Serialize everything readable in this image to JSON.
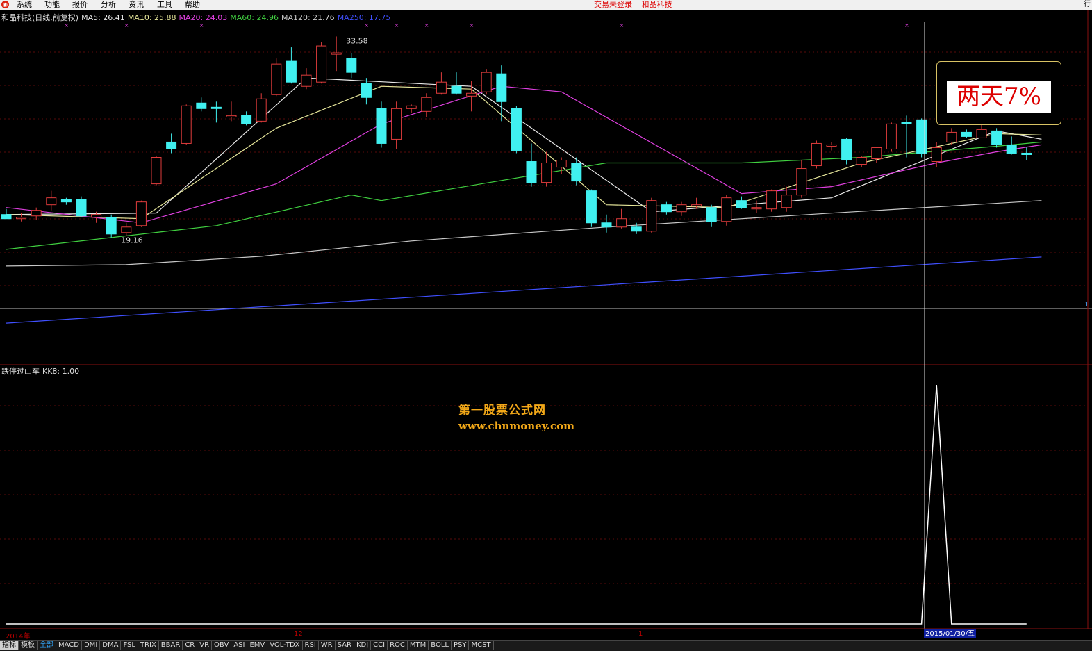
{
  "menu": {
    "logo": "◉",
    "items": [
      "系统",
      "功能",
      "报价",
      "分析",
      "资讯",
      "工具",
      "帮助"
    ],
    "status": "交易未登录",
    "stock_name": "和晶科技",
    "right_text": "行"
  },
  "main_legend": [
    {
      "label": "和晶科技(日线,前复权)",
      "color": "#e0e0e0"
    },
    {
      "label": "MA5: 26.41",
      "color": "#e8e8e8"
    },
    {
      "label": "MA10: 25.88",
      "color": "#e6e69a"
    },
    {
      "label": "MA20: 24.03",
      "color": "#e040e0"
    },
    {
      "label": "MA60: 24.96",
      "color": "#40d040"
    },
    {
      "label": "MA120: 21.76",
      "color": "#c8c8c8"
    },
    {
      "label": "MA250: 17.75",
      "color": "#4050ff"
    }
  ],
  "price_labels": {
    "high": "33.58",
    "low": "19.16",
    "axis_mark": "1"
  },
  "callout": {
    "text": "两天7%"
  },
  "indicator_legend": {
    "name": "跌停过山车",
    "value": "KK8: 1.00"
  },
  "watermark": {
    "line1": "第一股票公式网",
    "line2": "www.chnmoney.com"
  },
  "time_axis": {
    "labels": [
      "2014年",
      "12",
      "1"
    ],
    "cursor_date": "2015/01/30/五"
  },
  "tabs": [
    {
      "label": "指标",
      "state": "hi"
    },
    {
      "label": "模板",
      "state": ""
    },
    {
      "label": "全部",
      "state": "sel"
    },
    {
      "label": "MACD",
      "state": ""
    },
    {
      "label": "DMI",
      "state": ""
    },
    {
      "label": "DMA",
      "state": ""
    },
    {
      "label": "FSL",
      "state": ""
    },
    {
      "label": "TRIX",
      "state": ""
    },
    {
      "label": "BBAR",
      "state": ""
    },
    {
      "label": "CR",
      "state": ""
    },
    {
      "label": "VR",
      "state": ""
    },
    {
      "label": "OBV",
      "state": ""
    },
    {
      "label": "ASI",
      "state": ""
    },
    {
      "label": "EMV",
      "state": ""
    },
    {
      "label": "VOL-TDX",
      "state": ""
    },
    {
      "label": "RSI",
      "state": ""
    },
    {
      "label": "WR",
      "state": ""
    },
    {
      "label": "SAR",
      "state": ""
    },
    {
      "label": "KDJ",
      "state": ""
    },
    {
      "label": "CCI",
      "state": ""
    },
    {
      "label": "ROC",
      "state": ""
    },
    {
      "label": "MTM",
      "state": ""
    },
    {
      "label": "BOLL",
      "state": ""
    },
    {
      "label": "PSY",
      "state": ""
    },
    {
      "label": "MCST",
      "state": ""
    }
  ],
  "chart_data": {
    "type": "candlestick",
    "price_range": [
      15.5,
      34.2
    ],
    "colors": {
      "up": "#e03c3c",
      "down": "#40f0f0"
    },
    "candles": [
      {
        "o": 20.8,
        "h": 21.2,
        "l": 20.5,
        "c": 20.5
      },
      {
        "o": 20.5,
        "h": 20.9,
        "l": 20.3,
        "c": 20.6
      },
      {
        "o": 20.7,
        "h": 21.3,
        "l": 20.4,
        "c": 21.1
      },
      {
        "o": 21.5,
        "h": 22.5,
        "l": 21.1,
        "c": 22.0
      },
      {
        "o": 21.9,
        "h": 22.0,
        "l": 21.5,
        "c": 21.7
      },
      {
        "o": 21.9,
        "h": 22.1,
        "l": 20.6,
        "c": 20.7
      },
      {
        "o": 20.6,
        "h": 21.0,
        "l": 20.2,
        "c": 20.8
      },
      {
        "o": 20.6,
        "h": 20.8,
        "l": 19.16,
        "c": 19.4
      },
      {
        "o": 19.5,
        "h": 20.2,
        "l": 19.3,
        "c": 19.9
      },
      {
        "o": 20.0,
        "h": 21.8,
        "l": 19.9,
        "c": 21.7
      },
      {
        "o": 23.0,
        "h": 25.0,
        "l": 22.9,
        "c": 24.9
      },
      {
        "o": 26.0,
        "h": 26.6,
        "l": 25.2,
        "c": 25.5
      },
      {
        "o": 25.9,
        "h": 28.7,
        "l": 25.8,
        "c": 28.6
      },
      {
        "o": 28.8,
        "h": 29.2,
        "l": 28.2,
        "c": 28.4
      },
      {
        "o": 28.5,
        "h": 28.9,
        "l": 27.4,
        "c": 28.4
      },
      {
        "o": 27.8,
        "h": 28.9,
        "l": 27.5,
        "c": 27.9
      },
      {
        "o": 27.9,
        "h": 28.2,
        "l": 27.2,
        "c": 27.3
      },
      {
        "o": 27.5,
        "h": 29.5,
        "l": 27.4,
        "c": 29.1
      },
      {
        "o": 29.4,
        "h": 32.0,
        "l": 29.3,
        "c": 31.6
      },
      {
        "o": 31.8,
        "h": 32.8,
        "l": 30.2,
        "c": 30.3
      },
      {
        "o": 30.0,
        "h": 31.3,
        "l": 29.8,
        "c": 30.8
      },
      {
        "o": 30.3,
        "h": 33.2,
        "l": 30.2,
        "c": 32.9
      },
      {
        "o": 32.3,
        "h": 33.58,
        "l": 31.1,
        "c": 32.4
      },
      {
        "o": 32.0,
        "h": 32.4,
        "l": 30.6,
        "c": 31.0
      },
      {
        "o": 30.2,
        "h": 30.6,
        "l": 28.7,
        "c": 29.2
      },
      {
        "o": 28.4,
        "h": 28.9,
        "l": 25.6,
        "c": 25.9
      },
      {
        "o": 26.2,
        "h": 28.9,
        "l": 25.5,
        "c": 28.4
      },
      {
        "o": 28.4,
        "h": 28.7,
        "l": 28.1,
        "c": 28.6
      },
      {
        "o": 28.2,
        "h": 29.5,
        "l": 27.8,
        "c": 29.2
      },
      {
        "o": 29.5,
        "h": 31.0,
        "l": 29.4,
        "c": 30.3
      },
      {
        "o": 30.0,
        "h": 31.0,
        "l": 29.4,
        "c": 29.5
      },
      {
        "o": 29.3,
        "h": 30.4,
        "l": 28.2,
        "c": 29.5
      },
      {
        "o": 29.6,
        "h": 31.2,
        "l": 29.4,
        "c": 31.0
      },
      {
        "o": 30.9,
        "h": 31.5,
        "l": 27.5,
        "c": 28.9
      },
      {
        "o": 28.4,
        "h": 28.6,
        "l": 25.2,
        "c": 25.4
      },
      {
        "o": 24.6,
        "h": 25.9,
        "l": 22.8,
        "c": 23.1
      },
      {
        "o": 23.1,
        "h": 25.3,
        "l": 22.8,
        "c": 24.5
      },
      {
        "o": 24.2,
        "h": 24.9,
        "l": 23.7,
        "c": 24.7
      },
      {
        "o": 24.5,
        "h": 24.9,
        "l": 22.9,
        "c": 23.2
      },
      {
        "o": 22.5,
        "h": 22.6,
        "l": 19.9,
        "c": 20.2
      },
      {
        "o": 20.2,
        "h": 20.8,
        "l": 19.5,
        "c": 19.9
      },
      {
        "o": 19.9,
        "h": 21.2,
        "l": 19.8,
        "c": 20.5
      },
      {
        "o": 19.9,
        "h": 20.2,
        "l": 19.4,
        "c": 19.6
      },
      {
        "o": 19.6,
        "h": 22.0,
        "l": 19.5,
        "c": 21.8
      },
      {
        "o": 21.5,
        "h": 21.7,
        "l": 20.8,
        "c": 21.0
      },
      {
        "o": 21.0,
        "h": 21.7,
        "l": 20.7,
        "c": 21.5
      },
      {
        "o": 21.5,
        "h": 22.0,
        "l": 21.2,
        "c": 21.5
      },
      {
        "o": 21.3,
        "h": 21.5,
        "l": 19.9,
        "c": 20.3
      },
      {
        "o": 20.3,
        "h": 22.2,
        "l": 20.0,
        "c": 22.0
      },
      {
        "o": 21.8,
        "h": 22.1,
        "l": 21.2,
        "c": 21.3
      },
      {
        "o": 21.2,
        "h": 21.8,
        "l": 20.9,
        "c": 21.3
      },
      {
        "o": 21.2,
        "h": 22.6,
        "l": 21.0,
        "c": 22.5
      },
      {
        "o": 21.3,
        "h": 22.8,
        "l": 21.0,
        "c": 22.2
      },
      {
        "o": 22.2,
        "h": 24.7,
        "l": 22.0,
        "c": 24.1
      },
      {
        "o": 24.3,
        "h": 26.1,
        "l": 24.1,
        "c": 25.9
      },
      {
        "o": 25.8,
        "h": 26.0,
        "l": 25.4,
        "c": 25.8
      },
      {
        "o": 26.2,
        "h": 26.3,
        "l": 24.4,
        "c": 24.7
      },
      {
        "o": 24.4,
        "h": 25.0,
        "l": 24.2,
        "c": 24.9
      },
      {
        "o": 24.8,
        "h": 25.6,
        "l": 24.5,
        "c": 25.6
      },
      {
        "o": 25.5,
        "h": 27.4,
        "l": 25.3,
        "c": 27.3
      },
      {
        "o": 27.4,
        "h": 27.9,
        "l": 24.9,
        "c": 27.3
      },
      {
        "o": 27.6,
        "h": 27.7,
        "l": 24.9,
        "c": 25.2
      },
      {
        "o": 24.6,
        "h": 26.0,
        "l": 24.2,
        "c": 25.6
      },
      {
        "o": 26.0,
        "h": 27.0,
        "l": 25.8,
        "c": 26.7
      },
      {
        "o": 26.7,
        "h": 26.9,
        "l": 26.3,
        "c": 26.4
      },
      {
        "o": 26.3,
        "h": 27.4,
        "l": 26.3,
        "c": 26.9
      },
      {
        "o": 26.8,
        "h": 27.0,
        "l": 25.6,
        "c": 25.8
      },
      {
        "o": 25.8,
        "h": 26.4,
        "l": 25.1,
        "c": 25.2
      },
      {
        "o": 25.2,
        "h": 25.6,
        "l": 24.7,
        "c": 25.1
      }
    ],
    "ma_lines": [
      {
        "name": "MA5",
        "color": "#e8e8e8",
        "x": [
          0,
          10,
          20,
          31,
          43,
          55,
          66,
          69
        ],
        "y": [
          20.8,
          20.9,
          30.6,
          30.0,
          21.0,
          22.0,
          26.8,
          26.2
        ]
      },
      {
        "name": "MA10",
        "color": "#e6e69a",
        "x": [
          0,
          9,
          18,
          25,
          31,
          40,
          48,
          57,
          66,
          69
        ],
        "y": [
          20.8,
          20.5,
          27.0,
          30.0,
          29.8,
          21.5,
          21.3,
          24.5,
          26.6,
          26.5
        ]
      },
      {
        "name": "MA20",
        "color": "#e040e0",
        "x": [
          0,
          9,
          18,
          25,
          33,
          37,
          49,
          55,
          62,
          66,
          69
        ],
        "y": [
          21.3,
          20.2,
          23.0,
          27.3,
          30.0,
          29.6,
          22.3,
          22.8,
          24.5,
          25.3,
          25.8
        ]
      },
      {
        "name": "MA60",
        "color": "#40d040",
        "x": [
          0,
          14,
          23,
          25,
          40,
          49,
          57,
          66,
          69
        ],
        "y": [
          18.3,
          20.0,
          22.2,
          21.8,
          24.5,
          24.5,
          24.9,
          25.7,
          26.0
        ]
      },
      {
        "name": "MA120",
        "color": "#c8c8c8",
        "x": [
          0,
          8,
          17,
          27,
          40,
          55,
          69
        ],
        "y": [
          17.1,
          17.2,
          17.8,
          18.9,
          19.9,
          20.9,
          21.8
        ]
      },
      {
        "name": "MA250",
        "color": "#4050ff",
        "x": [
          0,
          69
        ],
        "y": [
          13.0,
          17.75
        ]
      }
    ],
    "indicator": {
      "name": "KK8",
      "type": "line",
      "range": [
        0,
        1
      ],
      "peak_index": 62,
      "values_description": "zero except 1.00 at index 62"
    }
  }
}
